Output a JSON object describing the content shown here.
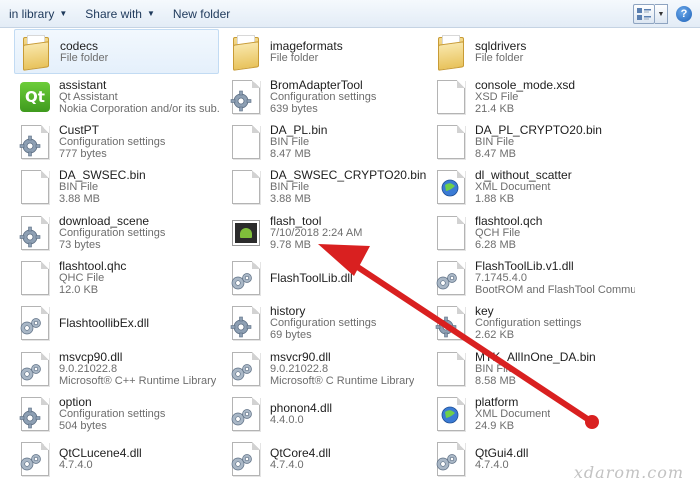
{
  "toolbar": {
    "library_label": "in library",
    "share_label": "Share with",
    "new_folder_label": "New folder"
  },
  "files": [
    {
      "name": "codecs",
      "line2": "File folder",
      "line3": "",
      "icon": "folder-icon",
      "selected": true
    },
    {
      "name": "imageformats",
      "line2": "File folder",
      "line3": "",
      "icon": "folder-icon"
    },
    {
      "name": "sqldrivers",
      "line2": "File folder",
      "line3": "",
      "icon": "folder-icon"
    },
    {
      "name": "assistant",
      "line2": "Qt Assistant",
      "line3": "Nokia Corporation and/or its sub...",
      "icon": "qt-icon"
    },
    {
      "name": "BromAdapterTool",
      "line2": "Configuration settings",
      "line3": "639 bytes",
      "icon": "settings-file-icon"
    },
    {
      "name": "console_mode.xsd",
      "line2": "XSD File",
      "line3": "21.4 KB",
      "icon": "file-icon"
    },
    {
      "name": "CustPT",
      "line2": "Configuration settings",
      "line3": "777 bytes",
      "icon": "settings-file-icon"
    },
    {
      "name": "DA_PL.bin",
      "line2": "BIN File",
      "line3": "8.47 MB",
      "icon": "file-icon"
    },
    {
      "name": "DA_PL_CRYPTO20.bin",
      "line2": "BIN File",
      "line3": "8.47 MB",
      "icon": "file-icon"
    },
    {
      "name": "DA_SWSEC.bin",
      "line2": "BIN File",
      "line3": "3.88 MB",
      "icon": "file-icon"
    },
    {
      "name": "DA_SWSEC_CRYPTO20.bin",
      "line2": "BIN File",
      "line3": "3.88 MB",
      "icon": "file-icon"
    },
    {
      "name": "dl_without_scatter",
      "line2": "XML Document",
      "line3": "1.88 KB",
      "icon": "xml-file-icon"
    },
    {
      "name": "download_scene",
      "line2": "Configuration settings",
      "line3": "73 bytes",
      "icon": "settings-file-icon"
    },
    {
      "name": "flash_tool",
      "line2": "7/10/2018 2:24 AM",
      "line3": "9.78 MB",
      "icon": "app-icon"
    },
    {
      "name": "flashtool.qch",
      "line2": "QCH File",
      "line3": "6.28 MB",
      "icon": "file-icon"
    },
    {
      "name": "flashtool.qhc",
      "line2": "QHC File",
      "line3": "12.0 KB",
      "icon": "file-icon"
    },
    {
      "name": "FlashToolLib.dll",
      "line2": "",
      "line3": "",
      "icon": "dll-icon"
    },
    {
      "name": "FlashToolLib.v1.dll",
      "line2": "7.1745.4.0",
      "line3": "BootROM and FlashTool Commu...",
      "icon": "dll-icon"
    },
    {
      "name": "FlashtoollibEx.dll",
      "line2": "",
      "line3": "",
      "icon": "dll-icon"
    },
    {
      "name": "history",
      "line2": "Configuration settings",
      "line3": "69 bytes",
      "icon": "settings-file-icon"
    },
    {
      "name": "key",
      "line2": "Configuration settings",
      "line3": "2.62 KB",
      "icon": "settings-file-icon"
    },
    {
      "name": "msvcp90.dll",
      "line2": "9.0.21022.8",
      "line3": "Microsoft® C++ Runtime Library",
      "icon": "dll-icon"
    },
    {
      "name": "msvcr90.dll",
      "line2": "9.0.21022.8",
      "line3": "Microsoft® C Runtime Library",
      "icon": "dll-icon"
    },
    {
      "name": "MTK_AllInOne_DA.bin",
      "line2": "BIN File",
      "line3": "8.58 MB",
      "icon": "file-icon"
    },
    {
      "name": "option",
      "line2": "Configuration settings",
      "line3": "504 bytes",
      "icon": "settings-file-icon"
    },
    {
      "name": "phonon4.dll",
      "line2": "4.4.0.0",
      "line3": "",
      "icon": "dll-icon"
    },
    {
      "name": "platform",
      "line2": "XML Document",
      "line3": "24.9 KB",
      "icon": "xml-file-icon"
    },
    {
      "name": "QtCLucene4.dll",
      "line2": "4.7.4.0",
      "line3": "",
      "icon": "dll-icon"
    },
    {
      "name": "QtCore4.dll",
      "line2": "4.7.4.0",
      "line3": "",
      "icon": "dll-icon"
    },
    {
      "name": "QtGui4.dll",
      "line2": "4.7.4.0",
      "line3": "",
      "icon": "dll-icon"
    }
  ],
  "watermark": "xdarom.com",
  "colors": {
    "arrow": "#d92020",
    "selection": "#e5f0fb",
    "toolbar": "#e3ecf6"
  }
}
